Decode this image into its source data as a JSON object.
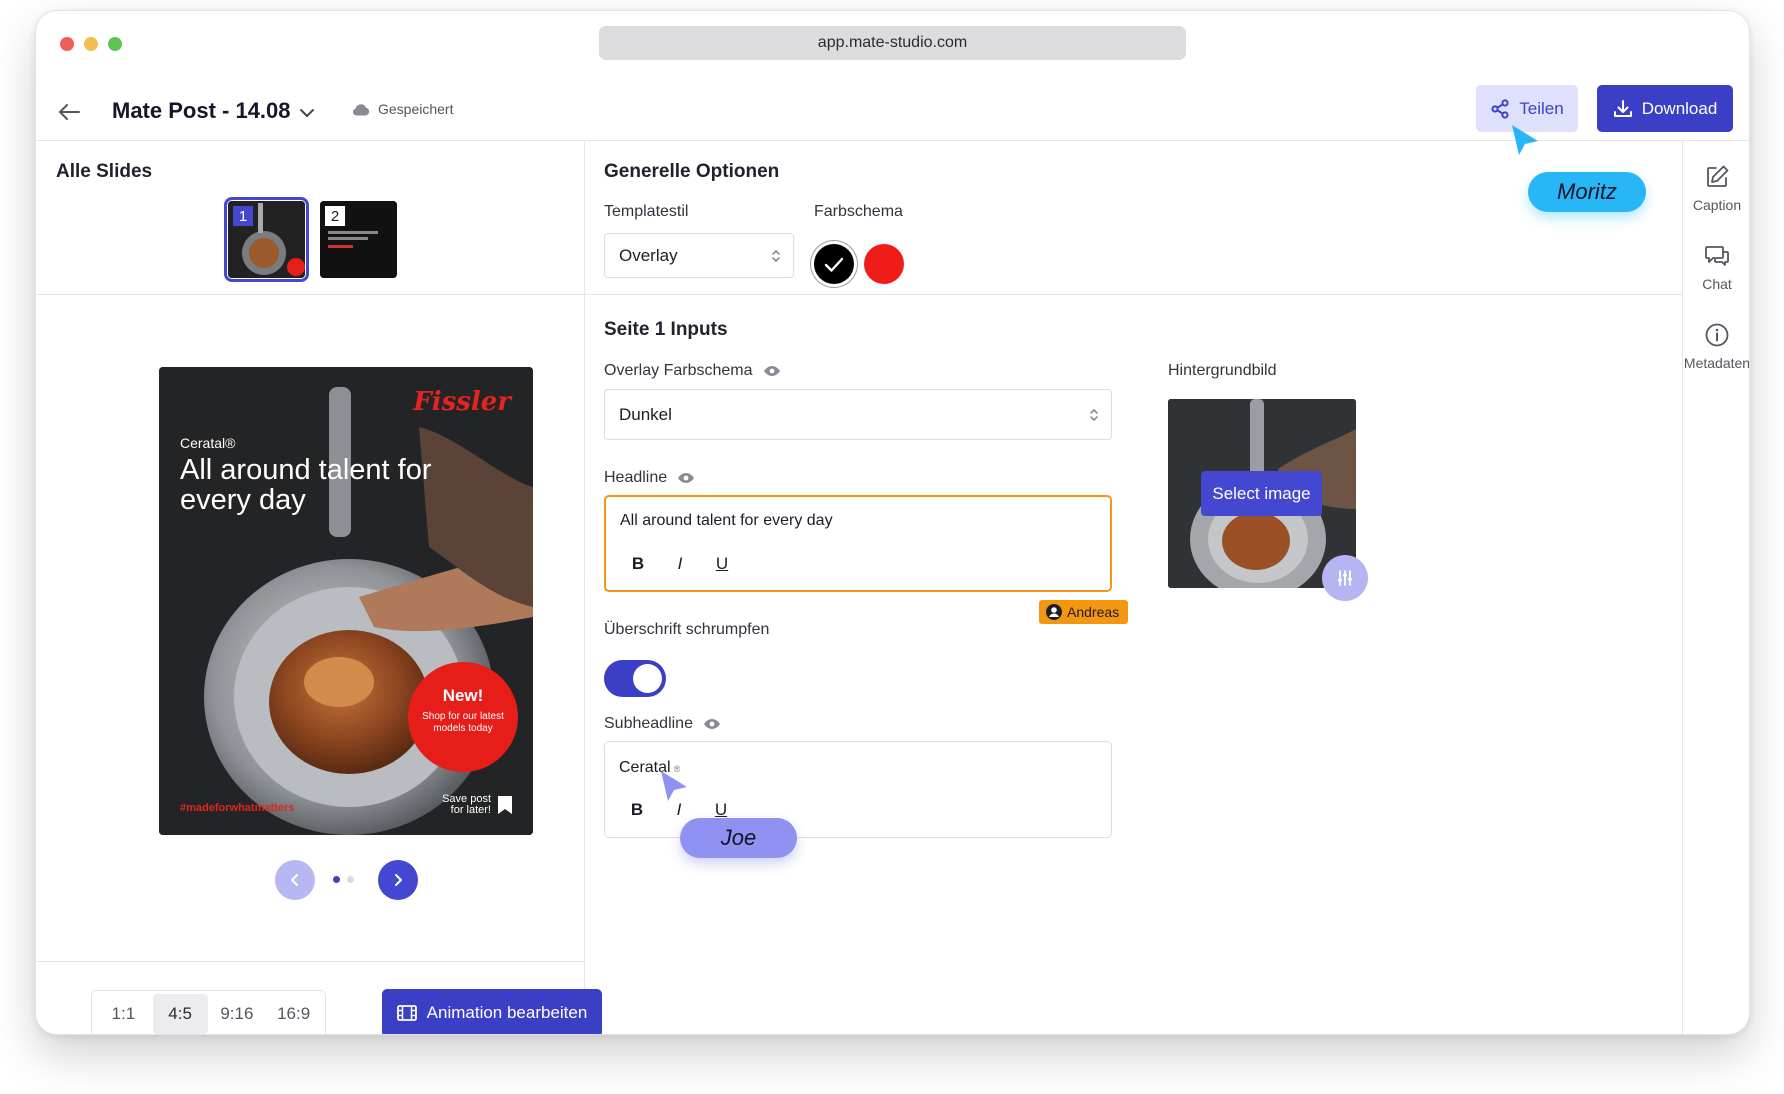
{
  "browser": {
    "url": "app.mate-studio.com"
  },
  "header": {
    "title": "Mate Post - 14.08",
    "save_status": "Gespeichert",
    "share_label": "Teilen",
    "download_label": "Download"
  },
  "rail": {
    "items": [
      {
        "label": "Caption",
        "icon": "edit-icon"
      },
      {
        "label": "Chat",
        "icon": "chat-icon"
      },
      {
        "label": "Metadaten",
        "icon": "info-icon"
      }
    ]
  },
  "slides": {
    "title": "Alle Slides",
    "thumbs": [
      {
        "number": "1",
        "active": true
      },
      {
        "number": "2",
        "active": false
      }
    ],
    "active_index": 1,
    "count": 2
  },
  "post": {
    "brand": "Fissler",
    "subheadline": "Ceratal®",
    "headline": "All around talent for every day",
    "badge_title": "New!",
    "badge_text": "Shop for our latest models today",
    "hashtag": "#madeforwhatmatters",
    "save_text": "Save post for later!"
  },
  "footer": {
    "ratios": [
      {
        "label": "1:1",
        "active": false
      },
      {
        "label": "4:5",
        "active": true
      },
      {
        "label": "9:16",
        "active": false
      },
      {
        "label": "16:9",
        "active": false
      }
    ],
    "animation_label": "Animation bearbeiten"
  },
  "general": {
    "title": "Generelle Optionen",
    "template_label": "Templatestil",
    "template_value": "Overlay",
    "color_label": "Farbschema",
    "colors": [
      "#000000",
      "#ef1c18"
    ],
    "selected_color": "#000000"
  },
  "inputs": {
    "title": "Seite 1 Inputs",
    "overlay_label": "Overlay Farbschema",
    "overlay_value": "Dunkel",
    "headline_label": "Headline",
    "headline_value": "All around talent for every day",
    "headline_editor": "Andreas",
    "shrink_label": "Überschrift schrumpfen",
    "shrink_enabled": true,
    "subheadline_label": "Subheadline",
    "subheadline_value": "Ceratal",
    "format": {
      "bold": "B",
      "italic": "I",
      "underline": "U"
    },
    "bg_label": "Hintergrundbild",
    "select_image_label": "Select image"
  },
  "collaborators": {
    "moritz": {
      "name": "Moritz",
      "color": "#29b6f6"
    },
    "joe": {
      "name": "Joe",
      "color": "#8f92f0"
    }
  },
  "colors": {
    "accent": "#3b3fc6",
    "accent_light": "#dfe0fb",
    "warning": "#f39612"
  }
}
